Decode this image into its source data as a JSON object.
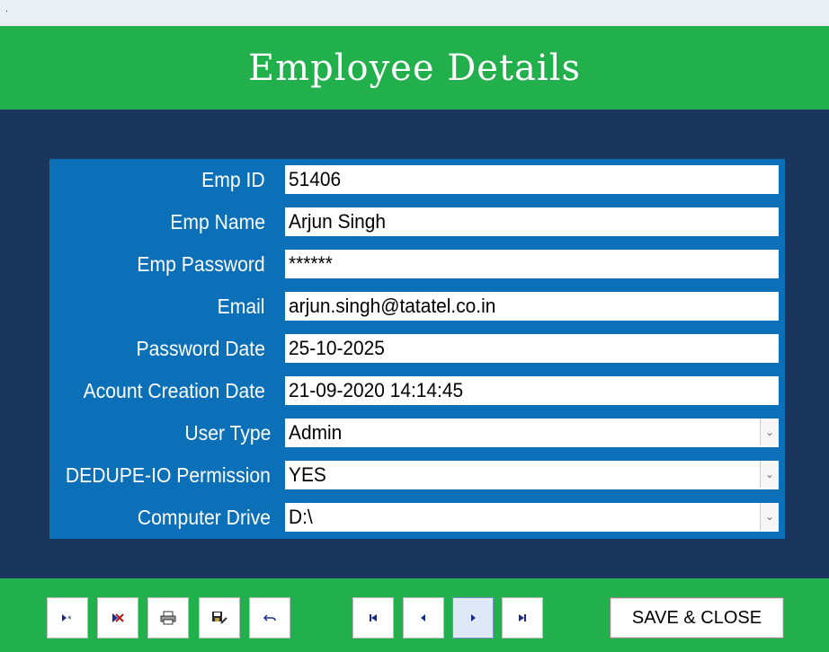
{
  "topbar": {
    "text": "."
  },
  "header": {
    "title": "Employee Details"
  },
  "form": {
    "fields": [
      {
        "label": "Emp ID",
        "value": "51406"
      },
      {
        "label": "Emp Name",
        "value": "Arjun Singh"
      },
      {
        "label": "Emp Password",
        "value": "******"
      },
      {
        "label": "Email",
        "value": "arjun.singh@tatatel.co.in"
      },
      {
        "label": "Password Date",
        "value": "25-10-2025"
      },
      {
        "label": "Acount Creation Date",
        "value": "21-09-2020 14:14:45"
      },
      {
        "label": "User Type",
        "value": "Admin"
      },
      {
        "label": "DEDUPE-IO Permission",
        "value": "YES"
      },
      {
        "label": "Computer Drive",
        "value": "D:\\"
      }
    ]
  },
  "footer": {
    "save_close_label": "SAVE & CLOSE",
    "icons": {
      "new_record": "new-record-icon",
      "delete_record": "delete-record-icon",
      "print": "print-icon",
      "save_record": "save-record-icon",
      "undo": "undo-icon",
      "first": "first-record-icon",
      "previous": "previous-record-icon",
      "next": "next-record-icon",
      "last": "last-record-icon"
    }
  },
  "colors": {
    "header_green": "#22b04c",
    "navy_background": "#1a365c",
    "form_blue": "#0b70b8"
  }
}
